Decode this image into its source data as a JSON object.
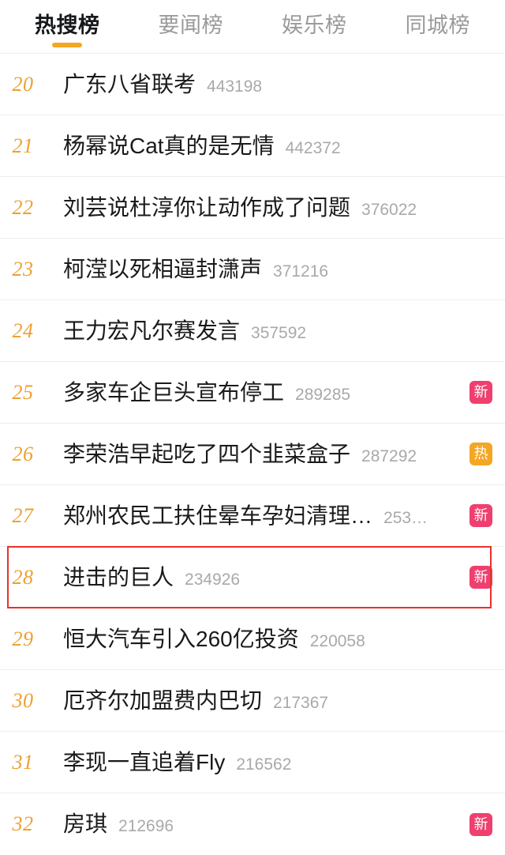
{
  "theme": {
    "accent_orange": "#f5a623",
    "rank_orange": "#eda030",
    "badge_new_bg": "#ef3f6e",
    "badge_hot_bg": "#f5a623",
    "highlight_border": "#e8312a",
    "title_color": "#1a1a1a",
    "count_color": "#a9a9a9",
    "tab_inactive_color": "#9a9a9a",
    "divider_color": "#ededed"
  },
  "tabs": [
    {
      "label": "热搜榜",
      "active": true
    },
    {
      "label": "要闻榜",
      "active": false
    },
    {
      "label": "娱乐榜",
      "active": false
    },
    {
      "label": "同城榜",
      "active": false
    }
  ],
  "list": {
    "rows": [
      {
        "rank": "20",
        "title": "广东八省联考",
        "count": "443198",
        "badge": "",
        "highlighted": false
      },
      {
        "rank": "21",
        "title": "杨幂说Cat真的是无情",
        "count": "442372",
        "badge": "",
        "highlighted": false
      },
      {
        "rank": "22",
        "title": "刘芸说杜淳你让动作成了问题",
        "count": "376022",
        "badge": "",
        "highlighted": false
      },
      {
        "rank": "23",
        "title": "柯滢以死相逼封潇声",
        "count": "371216",
        "badge": "",
        "highlighted": false
      },
      {
        "rank": "24",
        "title": "王力宏凡尔赛发言",
        "count": "357592",
        "badge": "",
        "highlighted": false
      },
      {
        "rank": "25",
        "title": "多家车企巨头宣布停工",
        "count": "289285",
        "badge": "新",
        "highlighted": false
      },
      {
        "rank": "26",
        "title": "李荣浩早起吃了四个韭菜盒子",
        "count": "287292",
        "badge": "热",
        "highlighted": false
      },
      {
        "rank": "27",
        "title": "郑州农民工扶住晕车孕妇清理…",
        "count": "253…",
        "badge": "新",
        "highlighted": false
      },
      {
        "rank": "28",
        "title": "进击的巨人",
        "count": "234926",
        "badge": "新",
        "highlighted": true
      },
      {
        "rank": "29",
        "title": "恒大汽车引入260亿投资",
        "count": "220058",
        "badge": "",
        "highlighted": false
      },
      {
        "rank": "30",
        "title": "厄齐尔加盟费内巴切",
        "count": "217367",
        "badge": "",
        "highlighted": false
      },
      {
        "rank": "31",
        "title": "李现一直追着Fly",
        "count": "216562",
        "badge": "",
        "highlighted": false
      },
      {
        "rank": "32",
        "title": "房琪",
        "count": "212696",
        "badge": "新",
        "highlighted": false
      }
    ]
  }
}
